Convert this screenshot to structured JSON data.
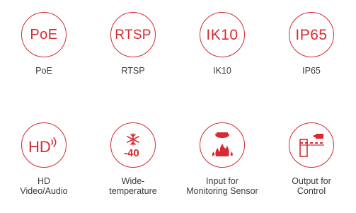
{
  "features": [
    {
      "badge": "PoE",
      "label_1": "PoE",
      "label_2": ""
    },
    {
      "badge": "RTSP",
      "label_1": "RTSP",
      "label_2": ""
    },
    {
      "badge": "IK10",
      "label_1": "IK10",
      "label_2": ""
    },
    {
      "badge": "IP65",
      "label_1": "IP65",
      "label_2": ""
    },
    {
      "badge": "HD",
      "label_1": "HD",
      "label_2": "Video/Audio",
      "icon": "hd-audio-icon"
    },
    {
      "badge": "-40",
      "label_1": "Wide-",
      "label_2": "temperature",
      "icon": "snowflake-icon"
    },
    {
      "badge": "",
      "label_1": "Input for",
      "label_2": "Monitoring Sensor",
      "icon": "fire-alarm-icon"
    },
    {
      "badge": "",
      "label_1": "Output for",
      "label_2": "Control",
      "icon": "barrier-gate-icon"
    }
  ],
  "colors": {
    "accent": "#d62b32",
    "text": "#3a3a3a",
    "background": "#ffffff"
  }
}
